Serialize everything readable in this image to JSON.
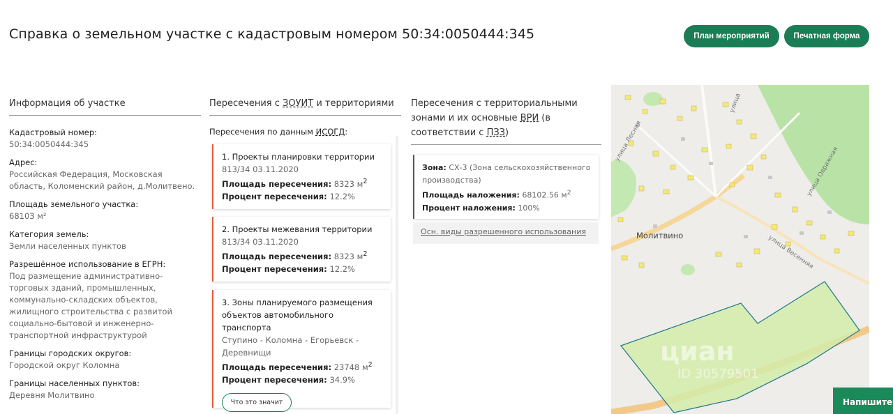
{
  "header": {
    "title": "Справка о земельном участке с кадастровым номером 50:34:0050444:345",
    "btn_plan": "План мероприятий",
    "btn_print": "Печатная форма"
  },
  "col1": {
    "heading": "Информация об участке",
    "fields": [
      {
        "label": "Кадастровый номер:",
        "value": "50:34:0050444:345"
      },
      {
        "label": "Адрес:",
        "value": "Российская Федерация, Московская область, Коломенский район, д.Молитвено."
      },
      {
        "label": "Площадь земельного участка:",
        "value": "68103 м²"
      },
      {
        "label": "Категория земель:",
        "value": "Земли населенных пунктов"
      },
      {
        "label": "Разрешённое использование в ЕГРН:",
        "value": "Под размещение административно-торговых зданий, промышленных, коммунально-складских объектов, жилищного строительства с развитой социально-бытовой и инженерно-транспортной инфраструктурой"
      },
      {
        "label": "Границы городских округов:",
        "value": "Городской округ Коломна"
      },
      {
        "label": "Границы населенных пунктов:",
        "value": "Деревня Молитвино"
      }
    ]
  },
  "col2": {
    "heading_pre": "Пересечения с ",
    "heading_abbr": "ЗОУИТ",
    "heading_post": " и территориями",
    "sub_pre": "Пересечения по данным ",
    "sub_abbr": "ИСОГД",
    "sub_post": ":",
    "area_label": "Площадь пересечения",
    "pct_label": "Процент пересечения",
    "cards": [
      {
        "title": "1. Проекты планировки территории",
        "doc": "813/34 03.11.2020",
        "area": "8323 м",
        "pct": "12.2%"
      },
      {
        "title": "2. Проекты межевания территории",
        "doc": "813/34 03.11.2020",
        "area": "8323 м",
        "pct": "12.2%"
      },
      {
        "title": "3. Зоны планируемого размещения объектов автомобильного транспорта",
        "doc": "Ступино - Коломна - Егорьевск - Деревнищи",
        "area": "23748 м",
        "pct": "34.9%"
      }
    ],
    "what_btn": "Что это значит"
  },
  "col3": {
    "heading_pre": "Пересечения с территориальными зонами и их основные ",
    "heading_abbr": "ВРИ",
    "heading_mid": " (в соответствии с ",
    "heading_abbr2": "ПЗЗ",
    "heading_post": ")",
    "zone_label": "Зона",
    "zone_value": "СХ-3 (Зона сельскохозяйственного производства)",
    "overlay_area_label": "Площадь наложения",
    "overlay_area_value": "68102.56 м",
    "overlay_pct_label": "Процент наложения",
    "overlay_pct_value": "100%",
    "link": "Осн. виды разрешенного использования"
  },
  "map": {
    "labels": {
      "village": "Молитвино",
      "street1": "улица Лесная",
      "street2": "улица",
      "street3": "улица Овражная",
      "street4": "улица Весенняя",
      "watermark": "циан",
      "watermark_id": "ID 30579501"
    },
    "colors": {
      "parcel_fill": "#d4ecaa",
      "parcel_stroke": "#2a7d8c",
      "road": "#f5d79a",
      "green": "#b9e3a6"
    }
  },
  "chat": {
    "label": "Напишите в"
  },
  "colors": {
    "accent": "#1a7d55",
    "card_border": "#e25b3c"
  }
}
